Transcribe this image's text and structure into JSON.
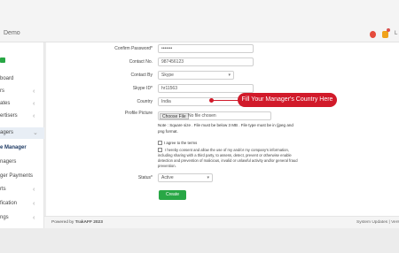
{
  "header": {
    "brand": "Demo",
    "user_initial": "L"
  },
  "sidebar": {
    "items": [
      {
        "label": "board",
        "chevron": ""
      },
      {
        "label": "rs",
        "chevron": "‹"
      },
      {
        "label": "ates",
        "chevron": "‹"
      },
      {
        "label": "ertisers",
        "chevron": "‹"
      },
      {
        "label": "agers",
        "chevron": "⌄"
      },
      {
        "label": "e Manager",
        "chevron": ""
      },
      {
        "label": "nagers",
        "chevron": ""
      },
      {
        "label": "ger Payments",
        "chevron": ""
      },
      {
        "label": "rts",
        "chevron": "‹"
      },
      {
        "label": "fication",
        "chevron": "‹"
      },
      {
        "label": "ngs",
        "chevron": "‹"
      }
    ]
  },
  "form": {
    "confirm_password": {
      "label": "Confirm Password*",
      "value": "•••••••"
    },
    "contact_no": {
      "label": "Contact No.",
      "value": "987456123"
    },
    "contact_by": {
      "label": "Contact By",
      "value": "Skype"
    },
    "skype_id": {
      "label": "Skype ID*",
      "value": "hr11563"
    },
    "country": {
      "label": "Country",
      "value": "India"
    },
    "profile_picture": {
      "label": "Profile Picture",
      "button": "Choose File",
      "file_name": "No file chosen",
      "note": "Note : Square size   . File must be below 3 MB . File type must be in (jpeg and png format."
    },
    "terms": "I agree to the terms",
    "consent": "I hereby consent and allow the use of my and/or my company's information, including sharing with a third party, to assess, detect, prevent or otherwise enable detection and prevention of malicious, invalid or unlawful activity and/or general fraud prevention.",
    "status": {
      "label": "Status*",
      "value": "Active"
    },
    "create_button": "Create"
  },
  "callout": {
    "text": "Fill Your Manager's Country Here",
    "color": "#d11a2a"
  },
  "footer": {
    "powered_prefix": "Powered by",
    "powered_brand": "TrakAFF 2023",
    "right": "System Updates | Vers"
  }
}
